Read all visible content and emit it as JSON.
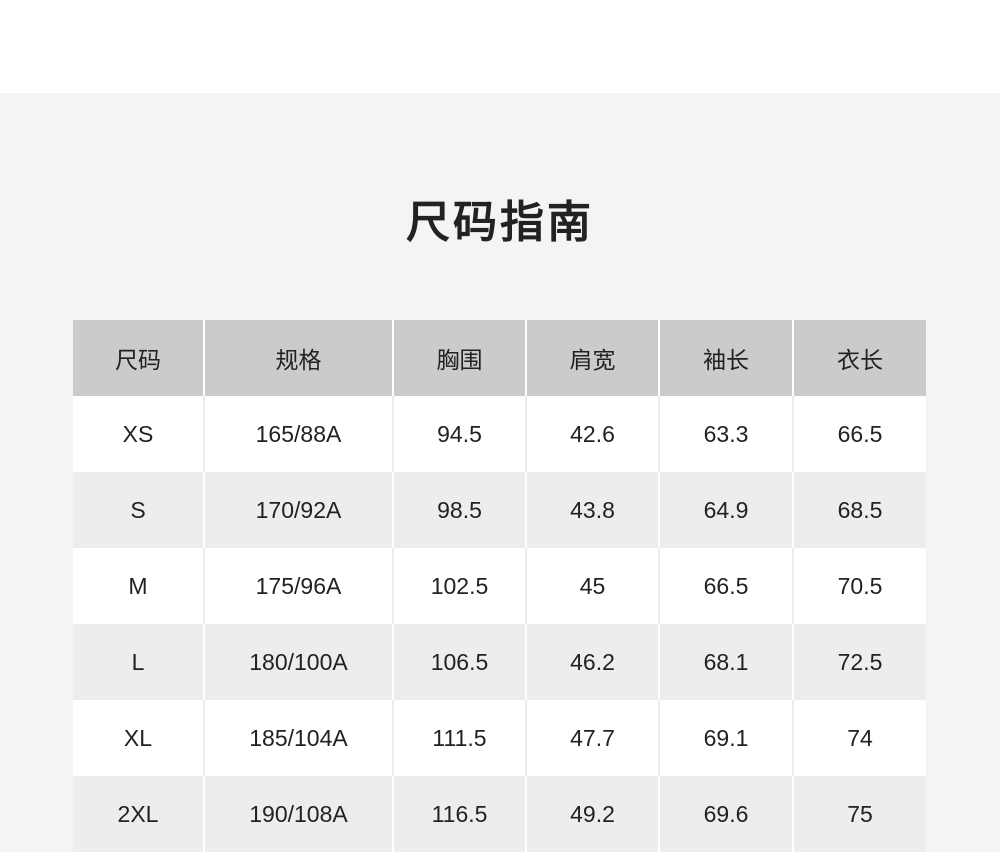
{
  "title": "尺码指南",
  "table": {
    "headers": [
      "尺码",
      "规格",
      "胸围",
      "肩宽",
      "袖长",
      "衣长"
    ],
    "rows": [
      [
        "XS",
        "165/88A",
        "94.5",
        "42.6",
        "63.3",
        "66.5"
      ],
      [
        "S",
        "170/92A",
        "98.5",
        "43.8",
        "64.9",
        "68.5"
      ],
      [
        "M",
        "175/96A",
        "102.5",
        "45",
        "66.5",
        "70.5"
      ],
      [
        "L",
        "180/100A",
        "106.5",
        "46.2",
        "68.1",
        "72.5"
      ],
      [
        "XL",
        "185/104A",
        "111.5",
        "47.7",
        "69.1",
        "74"
      ],
      [
        "2XL",
        "190/108A",
        "116.5",
        "49.2",
        "69.6",
        "75"
      ]
    ]
  },
  "colors": {
    "header_bg": "#cbcbcb",
    "panel_bg": "#f4f4f4",
    "row_alt_bg": "#ededed",
    "text": "#222222"
  }
}
